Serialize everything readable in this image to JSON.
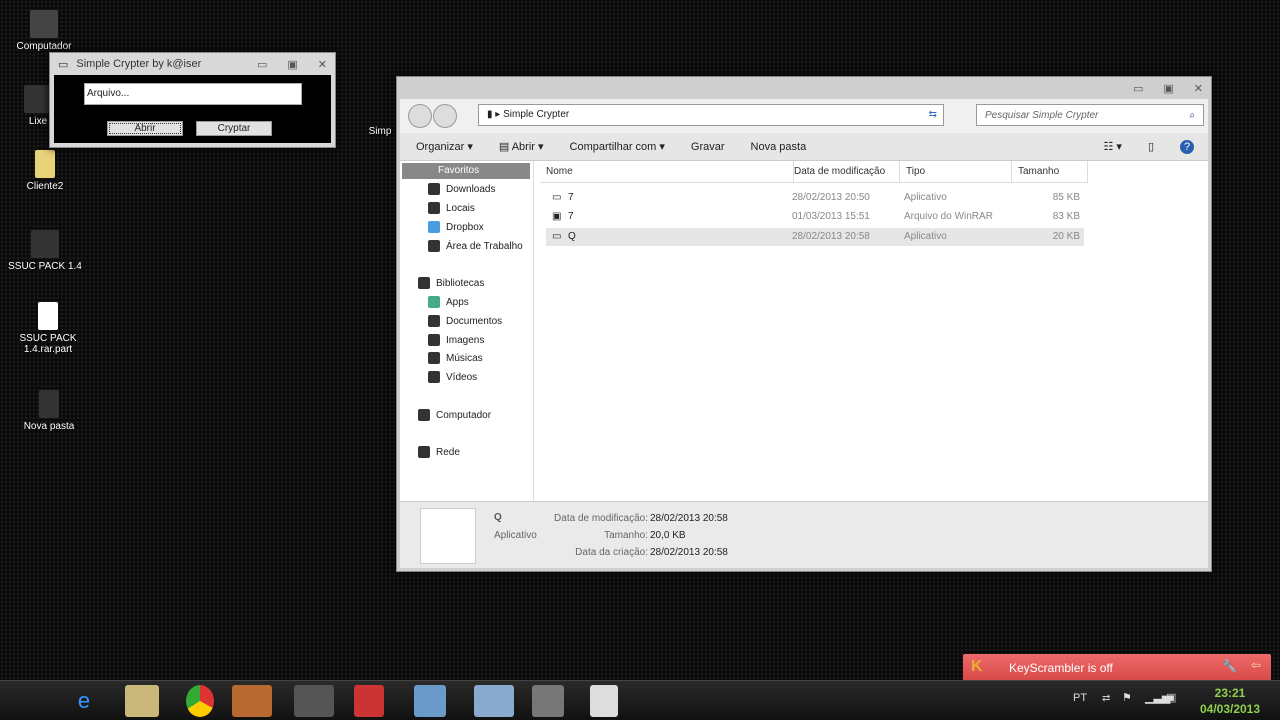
{
  "desktop": {
    "icons": [
      {
        "label": "Computador"
      },
      {
        "label": "Lixe"
      },
      {
        "label": "Cliente2"
      },
      {
        "label": "SSUC PACK 1.4"
      },
      {
        "label": "SSUC PACK 1.4.rar.part"
      },
      {
        "label": "Nova pasta"
      },
      {
        "label": "Simp"
      }
    ]
  },
  "crypter": {
    "title": "Simple Crypter by k@iser",
    "file_field": "Arquivo...",
    "open_label": "Abrir",
    "crypt_label": "Cryptar"
  },
  "explorer": {
    "breadcrumb": "Simple Crypter",
    "search_placeholder": "Pesquisar Simple Crypter",
    "toolbar": {
      "organize": "Organizar",
      "open": "Abrir",
      "share": "Compartilhar com",
      "burn": "Gravar",
      "new_folder": "Nova pasta"
    },
    "nav": {
      "favorites": "Favoritos",
      "fav_items": [
        "Downloads",
        "Locais",
        "Dropbox",
        "Área de Trabalho"
      ],
      "libraries": "Bibliotecas",
      "lib_items": [
        "Apps",
        "Documentos",
        "Imagens",
        "Músicas",
        "Vídeos"
      ],
      "computer": "Computador",
      "network": "Rede"
    },
    "columns": [
      "Nome",
      "Data de modificação",
      "Tipo",
      "Tamanho"
    ],
    "files": [
      {
        "name": "7",
        "date": "28/02/2013 20:50",
        "type": "Aplicativo",
        "size": "85 KB"
      },
      {
        "name": "7",
        "date": "01/03/2013 15:51",
        "type": "Arquivo do WinRAR",
        "size": "83 KB"
      },
      {
        "name": "Q",
        "date": "28/02/2013 20:58",
        "type": "Aplicativo",
        "size": "20 KB",
        "selected": true
      }
    ],
    "details": {
      "name": "Q",
      "type": "Aplicativo",
      "mod_label": "Data de modificação:",
      "mod": "28/02/2013 20:58",
      "size_label": "Tamanho:",
      "size": "20,0 KB",
      "created_label": "Data da criação:",
      "created": "28/02/2013 20:58"
    }
  },
  "notification": {
    "text": "KeyScrambler is off",
    "color": "#e05050"
  },
  "tray": {
    "lang": "PT",
    "time": "23:21",
    "date": "04/03/2013",
    "clock_color": "#8fd14f"
  }
}
